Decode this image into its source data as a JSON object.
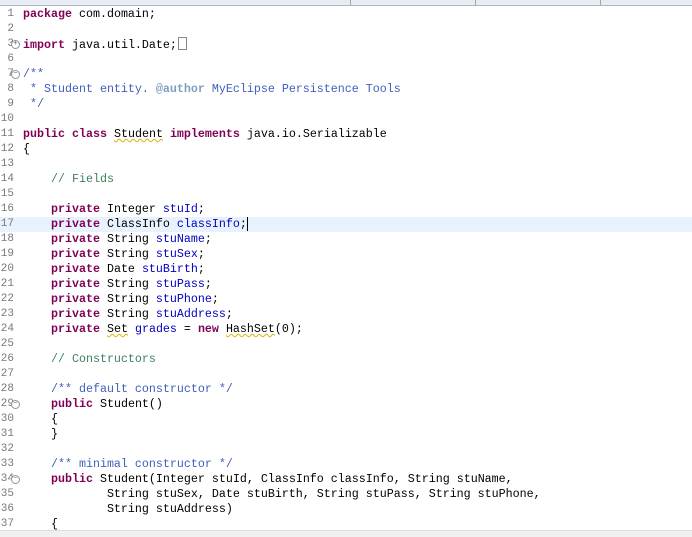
{
  "colors": {
    "keyword": "#7F0055",
    "field": "#0000C0",
    "comment": "#3F7F5F",
    "javadoc": "#3F5FBF",
    "current_line": "#E8F2FE"
  },
  "current_line": 17,
  "lines": [
    {
      "n": "1",
      "t": [
        [
          "kw",
          "package"
        ],
        [
          "",
          "com.domain;"
        ]
      ]
    },
    {
      "n": "2",
      "t": []
    },
    {
      "n": "3",
      "fold": "expand",
      "collapsed": true,
      "t": [
        [
          "kw",
          "import"
        ],
        [
          "",
          " java.util.Date;"
        ]
      ]
    },
    {
      "n": "6",
      "t": []
    },
    {
      "n": "7",
      "fold": "collapse",
      "t": [
        [
          "jd",
          "/**"
        ]
      ]
    },
    {
      "n": "8",
      "t": [
        [
          "jd",
          " * Student entity. "
        ],
        [
          "tag",
          "@author"
        ],
        [
          "jd",
          " MyEclipse Persistence Tools"
        ]
      ]
    },
    {
      "n": "9",
      "t": [
        [
          "jd",
          " */"
        ]
      ]
    },
    {
      "n": "10",
      "t": []
    },
    {
      "n": "11",
      "t": [
        [
          "kw",
          "public"
        ],
        [
          "",
          " "
        ],
        [
          "kw",
          "class"
        ],
        [
          "",
          " "
        ],
        [
          "w",
          "Student"
        ],
        [
          "",
          " "
        ],
        [
          "kw",
          "implements"
        ],
        [
          "",
          " java.io.Serializable"
        ]
      ]
    },
    {
      "n": "12",
      "t": [
        [
          "",
          "{"
        ]
      ]
    },
    {
      "n": "13",
      "t": []
    },
    {
      "n": "14",
      "t": [
        [
          "cm",
          "    // Fields"
        ]
      ]
    },
    {
      "n": "15",
      "t": []
    },
    {
      "n": "16",
      "t": [
        [
          "",
          "    "
        ],
        [
          "kw",
          "private"
        ],
        [
          "",
          " Integer "
        ],
        [
          "fd",
          "stuId"
        ],
        [
          "",
          ";"
        ]
      ]
    },
    {
      "n": "17",
      "t": [
        [
          "",
          "    "
        ],
        [
          "kw",
          "private"
        ],
        [
          "",
          " ClassInfo "
        ],
        [
          "fd",
          "classInfo"
        ],
        [
          "c",
          ";"
        ]
      ]
    },
    {
      "n": "18",
      "t": [
        [
          "",
          "    "
        ],
        [
          "kw",
          "private"
        ],
        [
          "",
          " String "
        ],
        [
          "fd",
          "stuName"
        ],
        [
          "",
          ";"
        ]
      ]
    },
    {
      "n": "19",
      "t": [
        [
          "",
          "    "
        ],
        [
          "kw",
          "private"
        ],
        [
          "",
          " String "
        ],
        [
          "fd",
          "stuSex"
        ],
        [
          "",
          ";"
        ]
      ]
    },
    {
      "n": "20",
      "t": [
        [
          "",
          "    "
        ],
        [
          "kw",
          "private"
        ],
        [
          "",
          " Date "
        ],
        [
          "fd",
          "stuBirth"
        ],
        [
          "",
          ";"
        ]
      ]
    },
    {
      "n": "21",
      "t": [
        [
          "",
          "    "
        ],
        [
          "kw",
          "private"
        ],
        [
          "",
          " String "
        ],
        [
          "fd",
          "stuPass"
        ],
        [
          "",
          ";"
        ]
      ]
    },
    {
      "n": "22",
      "t": [
        [
          "",
          "    "
        ],
        [
          "kw",
          "private"
        ],
        [
          "",
          " String "
        ],
        [
          "fd",
          "stuPhone"
        ],
        [
          "",
          ";"
        ]
      ]
    },
    {
      "n": "23",
      "t": [
        [
          "",
          "    "
        ],
        [
          "kw",
          "private"
        ],
        [
          "",
          " String "
        ],
        [
          "fd",
          "stuAddress"
        ],
        [
          "",
          ";"
        ]
      ]
    },
    {
      "n": "24",
      "t": [
        [
          "",
          "    "
        ],
        [
          "kw",
          "private"
        ],
        [
          "",
          " "
        ],
        [
          "w",
          "Set"
        ],
        [
          "",
          " "
        ],
        [
          "fd",
          "grades"
        ],
        [
          "",
          " = "
        ],
        [
          "kw",
          "new"
        ],
        [
          "",
          " "
        ],
        [
          "w",
          "HashSet"
        ],
        [
          "",
          "(0);"
        ]
      ]
    },
    {
      "n": "25",
      "t": []
    },
    {
      "n": "26",
      "t": [
        [
          "cm",
          "    // Constructors"
        ]
      ]
    },
    {
      "n": "27",
      "t": []
    },
    {
      "n": "28",
      "t": [
        [
          "jd",
          "    /** default constructor */"
        ]
      ]
    },
    {
      "n": "29",
      "fold": "collapse",
      "t": [
        [
          "",
          "    "
        ],
        [
          "kw",
          "public"
        ],
        [
          "",
          " Student()"
        ]
      ]
    },
    {
      "n": "30",
      "t": [
        [
          "",
          "    {"
        ]
      ]
    },
    {
      "n": "31",
      "t": [
        [
          "",
          "    }"
        ]
      ]
    },
    {
      "n": "32",
      "t": []
    },
    {
      "n": "33",
      "t": [
        [
          "jd",
          "    /** minimal constructor */"
        ]
      ]
    },
    {
      "n": "34",
      "fold": "collapse",
      "t": [
        [
          "",
          "    "
        ],
        [
          "kw",
          "public"
        ],
        [
          "",
          " Student(Integer stuId, ClassInfo classInfo, String stuName,"
        ]
      ]
    },
    {
      "n": "35",
      "t": [
        [
          "",
          "            String stuSex, Date stuBirth, String stuPass, String stuPhone,"
        ]
      ]
    },
    {
      "n": "36",
      "t": [
        [
          "",
          "            String stuAddress)"
        ]
      ]
    },
    {
      "n": "37",
      "t": [
        [
          "",
          "    {"
        ]
      ]
    }
  ]
}
